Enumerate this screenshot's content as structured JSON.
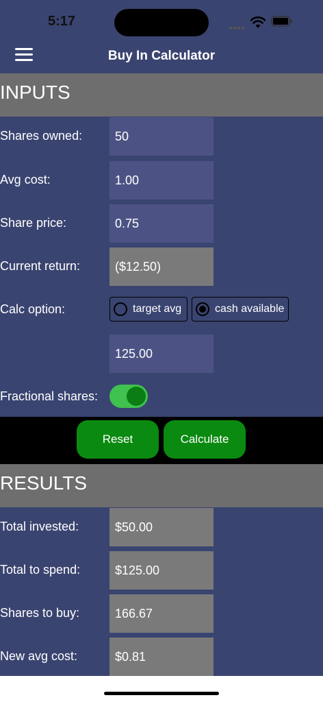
{
  "status_bar": {
    "time": "5:17"
  },
  "nav": {
    "title": "Buy In Calculator"
  },
  "inputs": {
    "header": "INPUTS",
    "shares_owned_label": "Shares owned:",
    "shares_owned_value": "50",
    "avg_cost_label": "Avg cost:",
    "avg_cost_value": "1.00",
    "share_price_label": "Share price:",
    "share_price_value": "0.75",
    "current_return_label": "Current return:",
    "current_return_value": "($12.50)",
    "calc_option_label": "Calc option:",
    "calc_options": [
      {
        "label": "target avg",
        "selected": false
      },
      {
        "label": "cash available",
        "selected": true
      }
    ],
    "amount_value": "125.00",
    "fractional_label": "Fractional shares:",
    "fractional_on": true
  },
  "actions": {
    "reset_label": "Reset",
    "calculate_label": "Calculate"
  },
  "results": {
    "header": "RESULTS",
    "total_invested_label": "Total invested:",
    "total_invested_value": "$50.00",
    "total_to_spend_label": "Total to spend:",
    "total_to_spend_value": "$125.00",
    "shares_to_buy_label": "Shares to buy:",
    "shares_to_buy_value": "166.67",
    "new_avg_cost_label": "New avg cost:",
    "new_avg_cost_value": "$0.81"
  },
  "colors": {
    "background": "#3a4470",
    "header": "#6e6e6e",
    "input_field": "#4c5384",
    "readonly_field": "#7a7a7a",
    "button": "#0a8a10",
    "toggle_on": "#3fc24f"
  }
}
